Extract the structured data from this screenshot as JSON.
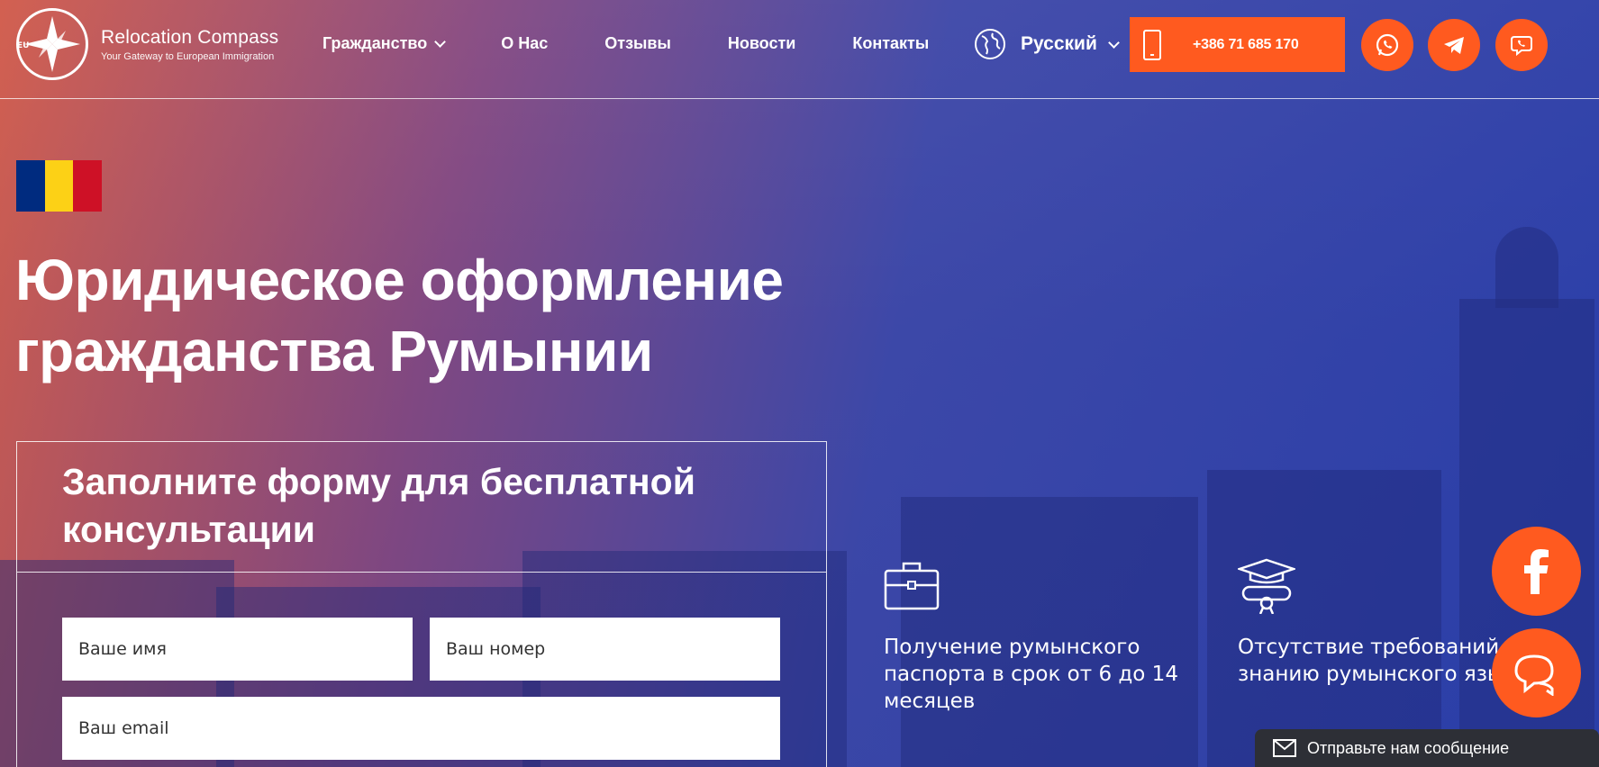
{
  "brand": {
    "badge": "EU",
    "title": "Relocation Compass",
    "subtitle": "Your Gateway to European Immigration"
  },
  "nav": {
    "items": [
      {
        "label": "Гражданство",
        "has_dropdown": true
      },
      {
        "label": "О Нас",
        "has_dropdown": false
      },
      {
        "label": "Отзывы",
        "has_dropdown": false
      },
      {
        "label": "Новости",
        "has_dropdown": false
      },
      {
        "label": "Контакты",
        "has_dropdown": false
      }
    ]
  },
  "language": {
    "label": "Русский",
    "icon": "globe-icon"
  },
  "phone": {
    "number": "+386 71 685 170",
    "icon": "mobile-phone-icon"
  },
  "social_header": [
    {
      "name": "whatsapp",
      "icon": "whatsapp-icon"
    },
    {
      "name": "telegram",
      "icon": "telegram-icon"
    },
    {
      "name": "viber",
      "icon": "viber-icon"
    }
  ],
  "hero": {
    "flag_colors": [
      "#002b7f",
      "#fcd116",
      "#ce1126"
    ],
    "headline_line1": "Юридическое оформление",
    "headline_line2": "гражданства Румынии"
  },
  "form": {
    "title": "Заполните форму для бесплатной консультации",
    "name_placeholder": "Ваше имя",
    "phone_placeholder": "Ваш номер",
    "email_placeholder": "Ваш email"
  },
  "features": [
    {
      "icon": "briefcase-icon",
      "text": "Получение румынского паспорта в срок от 6 до 14 месяцев"
    },
    {
      "icon": "graduation-diploma-icon",
      "text": "Отсутствие требований к знанию румынского языка"
    }
  ],
  "floating": {
    "facebook_icon": "facebook-icon",
    "chat_icon": "chat-bubbles-icon",
    "message_bar_label": "Отправьте нам сообщение"
  },
  "colors": {
    "accent": "#ff5a1f",
    "message_bar": "#2d2f36"
  }
}
